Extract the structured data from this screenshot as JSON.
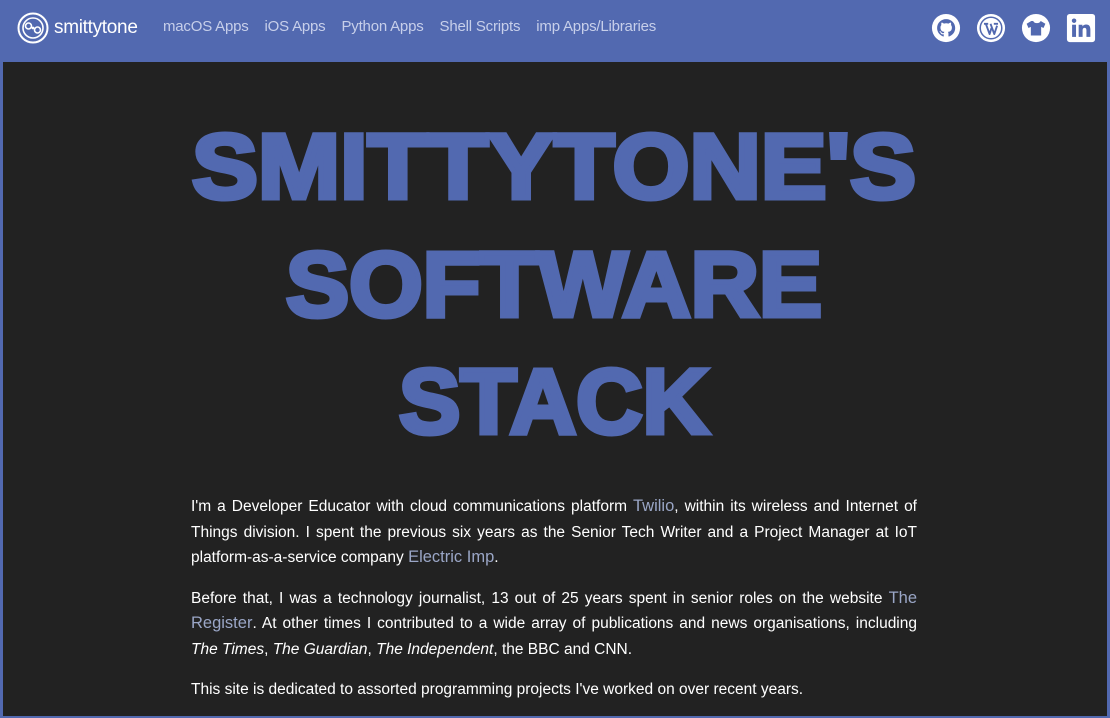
{
  "brand": {
    "name": "smittytone"
  },
  "nav": {
    "links": [
      "macOS Apps",
      "iOS Apps",
      "Python Apps",
      "Shell Scripts",
      "imp Apps/Libraries"
    ]
  },
  "social": [
    "github-icon",
    "wordpress-icon",
    "tshirt-icon",
    "linkedin-icon"
  ],
  "hero": {
    "title_lines": [
      "SMITTYTONE'S",
      "SOFTWARE",
      "STACK"
    ]
  },
  "intro": {
    "p1": {
      "t1": "I'm a Developer Educator with cloud communications platform ",
      "link1": "Twilio",
      "t2": ", within its wireless and Internet of Things division. I spent the previous six years as the Senior Tech Writer and a Project Manager at IoT platform-as-a-service company ",
      "link2": "Electric Imp",
      "t3": "."
    },
    "p2": {
      "t1": "Before that, I was a technology journalist, 13 out of 25 years spent in senior roles on the website ",
      "link1": "The Register",
      "t2": ". At other times I contributed to a wide array of publications and news organisations, including ",
      "em1": "The Times",
      "sep1": ", ",
      "em2": "The Guardian",
      "sep2": ", ",
      "em3": "The Independent",
      "t3": ", the BBC and CNN."
    },
    "p3": "This site is dedicated to assorted programming projects I've worked on over recent years."
  },
  "colors": {
    "brand_blue": "#5269b0",
    "panel_bg": "#222222",
    "link": "#9aa6c6",
    "nav_link": "#c7cfea"
  }
}
